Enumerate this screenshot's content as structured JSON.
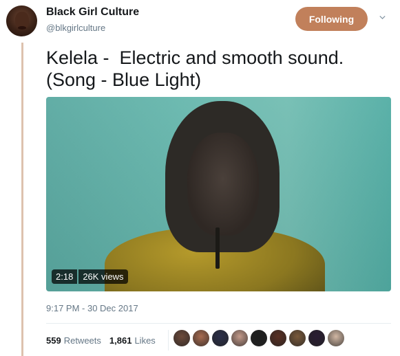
{
  "author": {
    "display_name": "Black Girl Culture",
    "handle": "@blkgirlculture"
  },
  "follow_button": {
    "label": "Following",
    "color": "#c1805b"
  },
  "tweet": {
    "text": "Kelela -  Electric and smooth sound.\n(Song - Blue Light)"
  },
  "video": {
    "duration": "2:18",
    "views": "26K views"
  },
  "timestamp": "9:17 PM - 30 Dec 2017",
  "stats": {
    "retweets_count": "559",
    "retweets_label": "Retweets",
    "likes_count": "1,861",
    "likes_label": "Likes"
  },
  "likers": [
    {
      "color": "#6d4a3a"
    },
    {
      "color": "#a86b50"
    },
    {
      "color": "#2b2f4a"
    },
    {
      "color": "#c49a8a"
    },
    {
      "color": "#1e1e1e"
    },
    {
      "color": "#5a2f22"
    },
    {
      "color": "#7a5a3b"
    },
    {
      "color": "#2a1d33"
    },
    {
      "color": "#d2b8a4"
    }
  ],
  "colors": {
    "thread_line": "#ddc2ae",
    "secondary_text": "#657786"
  }
}
